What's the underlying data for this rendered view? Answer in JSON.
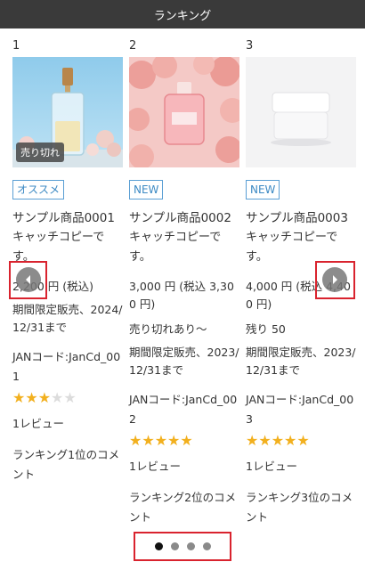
{
  "header": {
    "title": "ランキング"
  },
  "products": [
    {
      "rank": "1",
      "soldout_badge": "売り切れ",
      "tag": "オススメ",
      "name": "サンプル商品0001",
      "catch": "キャッチコピーです。",
      "price": "2,200 円 (税込)",
      "period": "期間限定販売、2024/12/31まで",
      "jan": "JANコード:JanCd_001",
      "rating": 3,
      "reviews": "1レビュー",
      "comment": "ランキング1位のコメント"
    },
    {
      "rank": "2",
      "tag": "NEW",
      "name": "サンプル商品0002",
      "catch": "キャッチコピーです。",
      "price": "3,000 円 (税込 3,300 円)",
      "stock": "売り切れあり～",
      "period": "期間限定販売、2023/12/31まで",
      "jan": "JANコード:JanCd_002",
      "rating": 5,
      "reviews": "1レビュー",
      "comment": "ランキング2位のコメント"
    },
    {
      "rank": "3",
      "tag": "NEW",
      "name": "サンプル商品0003",
      "catch": "キャッチコピーです。",
      "price": "4,000 円 (税込 4,400 円)",
      "stock": "残り 50",
      "period": "期間限定販売、2023/12/31まで",
      "jan": "JANコード:JanCd_003",
      "rating": 5,
      "reviews": "1レビュー",
      "comment": "ランキング3位のコメント"
    }
  ],
  "carousel": {
    "page_count": 4,
    "active_page": 1
  },
  "colors": {
    "header_bg": "#3a3a3a",
    "tag_blue": "#3d8ac4",
    "star": "#f2b01e",
    "highlight": "#d9232e"
  }
}
